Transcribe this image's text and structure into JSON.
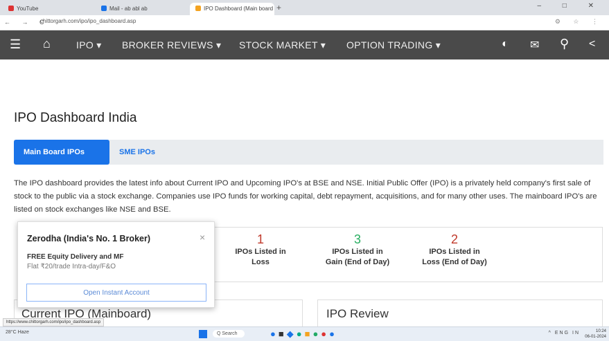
{
  "browser": {
    "tabs": [
      {
        "label": "YouTube",
        "color": "#d33"
      },
      {
        "label": "Mail - ab abl ab",
        "color": "#1a73e8"
      },
      {
        "label": "IPO Dashboard (Main board IPO...",
        "color": "#f4a321"
      }
    ],
    "new_tab": "+",
    "url": "chittorgarh.com/ipo/ipo_dashboard.asp",
    "nav": "← → C",
    "window_controls": "– □ ✕"
  },
  "mainnav": {
    "home_icon": "home-icon",
    "items": [
      "IPO ▾",
      "BROKER REVIEWS ▾",
      "STOCK MARKET ▾",
      "OPTION TRADING ▾"
    ]
  },
  "page": {
    "title": "IPO Dashboard India",
    "tabs": {
      "main": "Main Board IPOs",
      "sme": "SME IPOs"
    },
    "description": "The IPO dashboard provides the latest info about Current IPO and Upcoming IPO's at BSE and NSE. Initial Public Offer (IPO) is a privately held company's first sale of stock to the public via a stock exchange. Companies use IPO funds for working capital, debt repayment, acquisitions, and for many other uses. The mainboard IPO's are listed on stock exchanges like NSE and BSE.",
    "stats": [
      {
        "num": "1",
        "label_line1": "IPOs Listed in",
        "label_line2": "Loss",
        "color": "#c0392b"
      },
      {
        "num": "3",
        "label_line1": "IPOs Listed in",
        "label_line2": "Gain (End of Day)",
        "color": "#27ae60"
      },
      {
        "num": "2",
        "label_line1": "IPOs Listed in",
        "label_line2": "Loss (End of Day)",
        "color": "#c0392b"
      }
    ],
    "current_ipo_title": "Current IPO (Mainboard)",
    "ipo_review_title": "IPO Review"
  },
  "popup": {
    "title": "Zerodha (India's No. 1 Broker)",
    "close": "×",
    "line1": "FREE Equity Delivery and MF",
    "line2": "Flat ₹20/trade Intra-day/F&O",
    "button": "Open Instant Account"
  },
  "status_url": "https://www.chittorgarh.com/ipo/ipo_dashboard.asp",
  "taskbar": {
    "weather": "28°C Haze",
    "search": "Q Search",
    "tray": "^ ENG IN",
    "time": "10:24",
    "date": "06-01-2024"
  }
}
